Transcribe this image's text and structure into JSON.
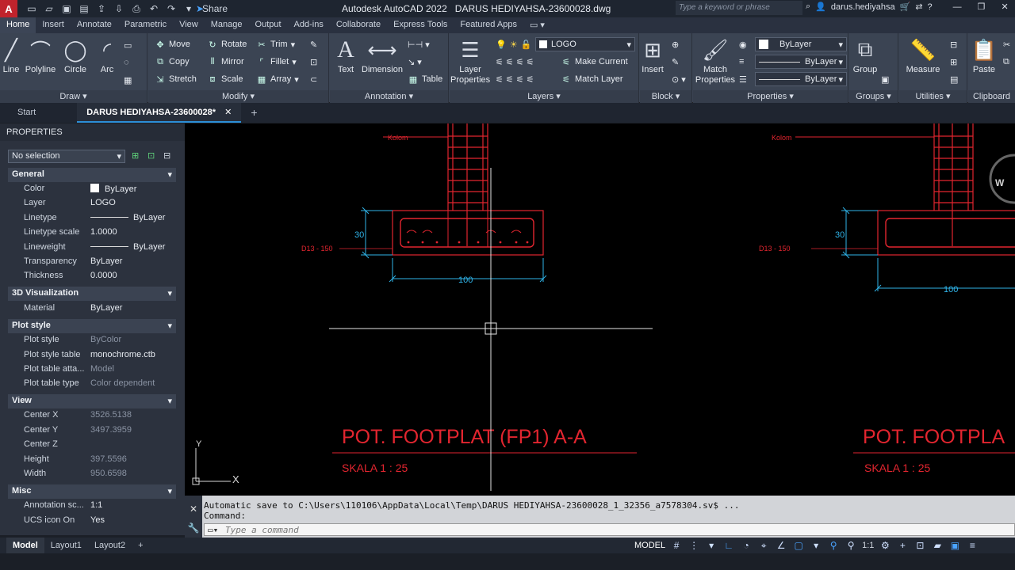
{
  "titlebar": {
    "logo": "A",
    "share": "Share",
    "app_title": "Autodesk AutoCAD 2022",
    "file_title": "DARUS HEDIYAHSA-23600028.dwg",
    "search_placeholder": "Type a keyword or phrase",
    "user": "darus.hediyahsa"
  },
  "ribbon_tabs": [
    "Home",
    "Insert",
    "Annotate",
    "Parametric",
    "View",
    "Manage",
    "Output",
    "Add-ins",
    "Collaborate",
    "Express Tools",
    "Featured Apps"
  ],
  "ribbon": {
    "draw": {
      "label": "Draw",
      "line": "Line",
      "polyline": "Polyline",
      "circle": "Circle",
      "arc": "Arc"
    },
    "modify": {
      "label": "Modify",
      "move": "Move",
      "rotate": "Rotate",
      "trim": "Trim",
      "copy": "Copy",
      "mirror": "Mirror",
      "fillet": "Fillet",
      "stretch": "Stretch",
      "scale": "Scale",
      "array": "Array"
    },
    "annotation": {
      "label": "Annotation",
      "text": "Text",
      "dimension": "Dimension",
      "table": "Table"
    },
    "layers": {
      "label": "Layers",
      "layer_properties": "Layer Properties",
      "current_layer": "LOGO",
      "make_current": "Make Current",
      "match_layer": "Match Layer"
    },
    "block": {
      "label": "Block",
      "insert": "Insert"
    },
    "properties": {
      "label": "Properties",
      "match": "Match Properties",
      "color": "ByLayer",
      "linetype": "ByLayer",
      "lineweight": "ByLayer"
    },
    "groups": {
      "label": "Groups",
      "group": "Group"
    },
    "utilities": {
      "label": "Utilities",
      "measure": "Measure"
    },
    "clipboard": {
      "label": "Clipboard",
      "paste": "Paste"
    }
  },
  "file_tabs": {
    "start": "Start",
    "active": "DARUS HEDIYAHSA-23600028*"
  },
  "properties": {
    "header": "PROPERTIES",
    "selection": "No selection",
    "sections": {
      "general": "General",
      "viz": "3D Visualization",
      "plot": "Plot style",
      "view": "View",
      "misc": "Misc"
    },
    "general": [
      {
        "k": "Color",
        "v": "ByLayer"
      },
      {
        "k": "Layer",
        "v": "LOGO"
      },
      {
        "k": "Linetype",
        "v": "ByLayer"
      },
      {
        "k": "Linetype scale",
        "v": "1.0000"
      },
      {
        "k": "Lineweight",
        "v": "ByLayer"
      },
      {
        "k": "Transparency",
        "v": "ByLayer"
      },
      {
        "k": "Thickness",
        "v": "0.0000"
      }
    ],
    "viz": [
      {
        "k": "Material",
        "v": "ByLayer"
      }
    ],
    "plot": [
      {
        "k": "Plot style",
        "v": "ByColor"
      },
      {
        "k": "Plot style table",
        "v": "monochrome.ctb"
      },
      {
        "k": "Plot table atta...",
        "v": "Model"
      },
      {
        "k": "Plot table type",
        "v": "Color dependent"
      }
    ],
    "view": [
      {
        "k": "Center X",
        "v": "3526.5138"
      },
      {
        "k": "Center Y",
        "v": "3497.3959"
      },
      {
        "k": "Center Z",
        "v": ""
      },
      {
        "k": "Height",
        "v": "397.5596"
      },
      {
        "k": "Width",
        "v": "950.6598"
      }
    ],
    "misc": [
      {
        "k": "Annotation sc...",
        "v": "1:1"
      },
      {
        "k": "UCS icon On",
        "v": "Yes"
      }
    ]
  },
  "drawing": {
    "kolom": "Kolom",
    "rebar": "D13 - 150",
    "dim_height": "30",
    "dim_width": "100",
    "title": "POT. FOOTPLAT (FP1) A-A",
    "title_right": "POT. FOOTPLA",
    "scale": "SKALA 1 : 25",
    "compass": "W",
    "ucs_x": "X",
    "ucs_y": "Y"
  },
  "command": {
    "history": "Automatic save to C:\\Users\\110106\\AppData\\Local\\Temp\\DARUS HEDIYAHSA-23600028_1_32356_a7578304.sv$ ...",
    "prompt": "Command:",
    "placeholder": "Type a command"
  },
  "status": {
    "layouts": [
      "Model",
      "Layout1",
      "Layout2"
    ],
    "model": "MODEL",
    "scale": "1:1"
  }
}
